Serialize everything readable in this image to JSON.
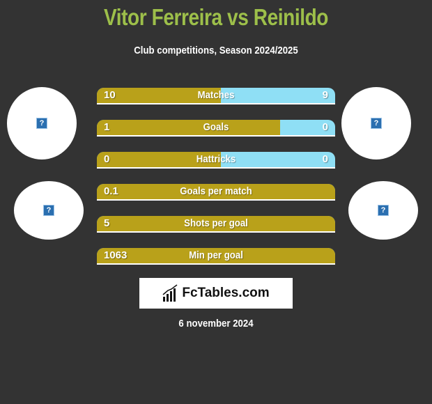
{
  "header": {
    "title": "Vitor Ferreira vs Reinildo",
    "subtitle": "Club competitions, Season 2024/2025"
  },
  "colors": {
    "title": "#9dbf4a",
    "left_bar": "#b9a11a",
    "right_bar": "#8fdff5",
    "background": "#333333"
  },
  "avatars": {
    "icon": "broken-image-icon",
    "glyph": "?"
  },
  "stats": [
    {
      "label": "Matches",
      "left": "10",
      "right": "9",
      "left_share": 0.52
    },
    {
      "label": "Goals",
      "left": "1",
      "right": "0",
      "left_share": 0.77
    },
    {
      "label": "Hattricks",
      "left": "0",
      "right": "0",
      "left_share": 0.52
    },
    {
      "label": "Goals per match",
      "left": "0.1",
      "right": "",
      "left_share": 1.0
    },
    {
      "label": "Shots per goal",
      "left": "5",
      "right": "",
      "left_share": 1.0
    },
    {
      "label": "Min per goal",
      "left": "1063",
      "right": "",
      "left_share": 1.0
    }
  ],
  "logo": {
    "text": "FcTables.com"
  },
  "footer": {
    "date": "6 november 2024"
  }
}
